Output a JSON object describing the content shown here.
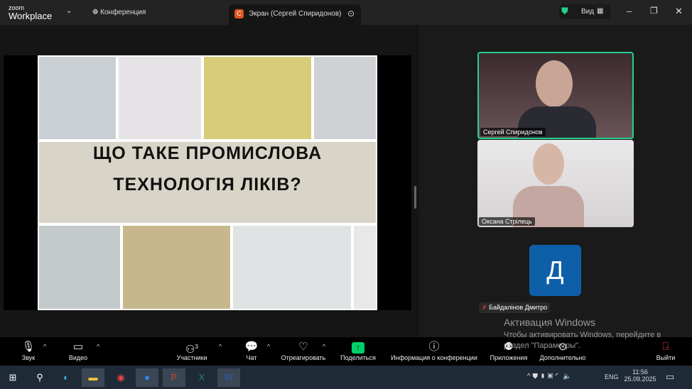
{
  "app": {
    "logo_small": "zoom",
    "logo_big": "Workplace",
    "meeting_label": "Конференция",
    "screen_tab": "Экран (Сергей Спиридонов)",
    "screen_badge": "С",
    "view_label": "Вид"
  },
  "slide": {
    "line1": "ЩО ТАКЕ ПРОМИСЛОВА",
    "line2": "ТЕХНОЛОГІЯ ЛІКІВ?"
  },
  "participants": [
    {
      "name": "Сергей Спиридонов"
    },
    {
      "name": "Оксана Стрілець"
    },
    {
      "name": "Байдалінов Дмитро",
      "initial": "Д"
    }
  ],
  "watermark": {
    "title": "Активация Windows",
    "text": "Чтобы активировать Windows, перейдите в раздел \"Параметры\"."
  },
  "toolbar": {
    "audio": "Звук",
    "video": "Видео",
    "participants": "Участники",
    "participants_count": "3",
    "chat": "Чат",
    "react": "Отреагировать",
    "share": "Поделиться",
    "info": "Информация о конференции",
    "apps": "Приложения",
    "more": "Дополнительно",
    "leave": "Выйти"
  },
  "taskbar": {
    "time": "11:56",
    "date": "25.09.2025",
    "lang": "ENG"
  },
  "colors": {
    "accent": "#0e5fa8",
    "share": "#00d26a",
    "speaker_border": "#23d18b"
  }
}
